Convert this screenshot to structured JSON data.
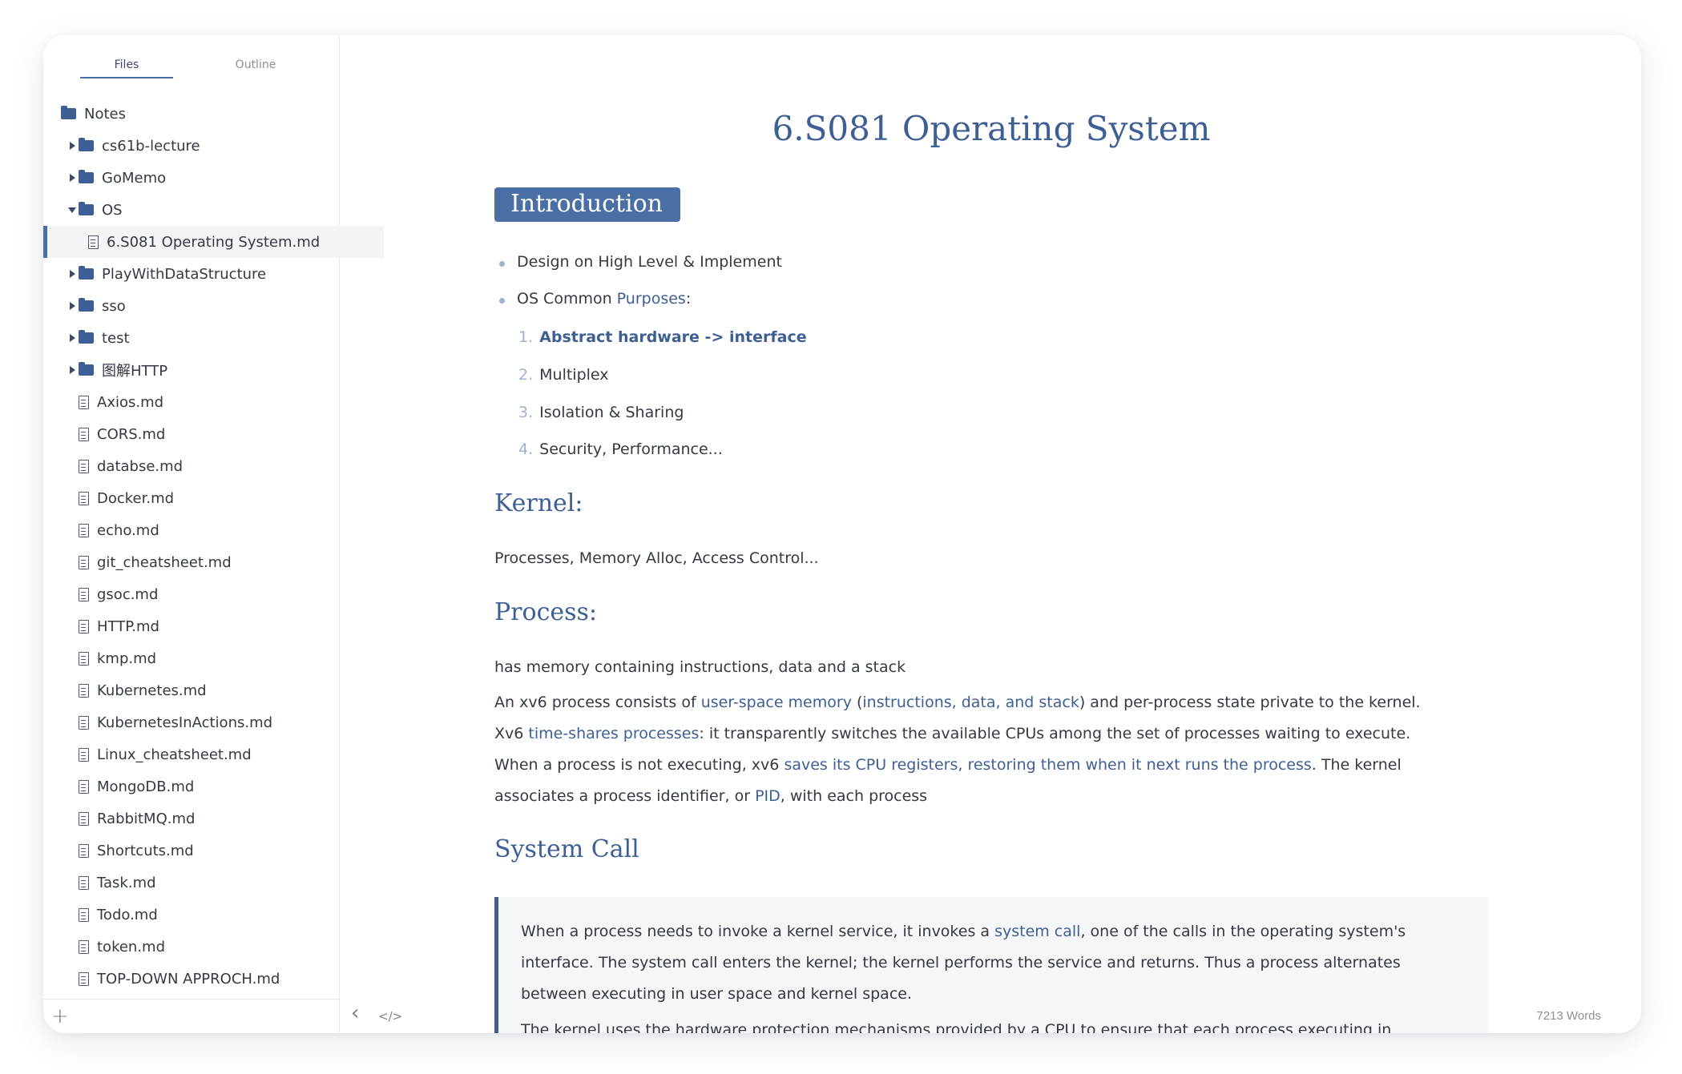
{
  "tabs": {
    "files": "Files",
    "outline": "Outline"
  },
  "tree": [
    {
      "label": "Notes",
      "type": "folder",
      "level": 0,
      "caret": "none"
    },
    {
      "label": "cs61b-lecture",
      "type": "folder",
      "level": 1,
      "caret": "right"
    },
    {
      "label": "GoMemo",
      "type": "folder",
      "level": 1,
      "caret": "right"
    },
    {
      "label": "OS",
      "type": "folder",
      "level": 1,
      "caret": "down"
    },
    {
      "label": "6.S081 Operating System.md",
      "type": "file",
      "level": 2,
      "selected": true
    },
    {
      "label": "PlayWithDataStructure",
      "type": "folder",
      "level": 1,
      "caret": "right"
    },
    {
      "label": "sso",
      "type": "folder",
      "level": 1,
      "caret": "right"
    },
    {
      "label": "test",
      "type": "folder",
      "level": 1,
      "caret": "right"
    },
    {
      "label": "图解HTTP",
      "type": "folder",
      "level": 1,
      "caret": "right"
    },
    {
      "label": "Axios.md",
      "type": "file",
      "level": 1
    },
    {
      "label": "CORS.md",
      "type": "file",
      "level": 1
    },
    {
      "label": "databse.md",
      "type": "file",
      "level": 1
    },
    {
      "label": "Docker.md",
      "type": "file",
      "level": 1
    },
    {
      "label": "echo.md",
      "type": "file",
      "level": 1
    },
    {
      "label": "git_cheatsheet.md",
      "type": "file",
      "level": 1
    },
    {
      "label": "gsoc.md",
      "type": "file",
      "level": 1
    },
    {
      "label": "HTTP.md",
      "type": "file",
      "level": 1
    },
    {
      "label": "kmp.md",
      "type": "file",
      "level": 1
    },
    {
      "label": "Kubernetes.md",
      "type": "file",
      "level": 1
    },
    {
      "label": "KubernetesInActions.md",
      "type": "file",
      "level": 1
    },
    {
      "label": "Linux_cheatsheet.md",
      "type": "file",
      "level": 1
    },
    {
      "label": "MongoDB.md",
      "type": "file",
      "level": 1
    },
    {
      "label": "RabbitMQ.md",
      "type": "file",
      "level": 1
    },
    {
      "label": "Shortcuts.md",
      "type": "file",
      "level": 1
    },
    {
      "label": "Task.md",
      "type": "file",
      "level": 1
    },
    {
      "label": "Todo.md",
      "type": "file",
      "level": 1
    },
    {
      "label": "token.md",
      "type": "file",
      "level": 1
    },
    {
      "label": "TOP-DOWN APPROCH.md",
      "type": "file",
      "level": 1
    }
  ],
  "sidebar_footer": {
    "add_label": "+"
  },
  "doc": {
    "title": "6.S081 Operating System",
    "intro_heading": "Introduction",
    "bullet1": "Design on High Level & Implement",
    "bullet2_pre": "OS Common ",
    "bullet2_link": "Purposes",
    "bullet2_post": ":",
    "num1_n": "1.",
    "num1": "Abstract hardware -> interface",
    "num2_n": "2.",
    "num2": "Multiplex",
    "num3_n": "3.",
    "num3": "Isolation & Sharing",
    "num4_n": "4.",
    "num4": "Security, Performance...",
    "kernel_heading": "Kernel:",
    "kernel_text": "Processes, Memory Alloc, Access Control...",
    "process_heading": "Process:",
    "process_text1": "has memory containing instructions, data and a stack",
    "p2_a": "An xv6 process consists of ",
    "p2_b": "user-space memory",
    "p2_c": " (",
    "p2_d": "instructions, data, and stack",
    "p2_e": ") and per-process state private to the kernel.",
    "p2_f": "Xv6 ",
    "p2_g": "time-shares processes",
    "p2_h": ": it transparently switches the available CPUs among the set of processes waiting to execute.",
    "p2_i": "When a process is not executing, xv6 ",
    "p2_j": "saves its CPU registers, restoring them when it next runs the process",
    "p2_k": ". The kernel",
    "p2_l": "associates a process identifier, or ",
    "p2_m": "PID",
    "p2_n": ", with each process",
    "syscall_heading": "System Call",
    "q1_a": "When a process needs to invoke a kernel service, it invokes a ",
    "q1_b": "system call",
    "q1_c": ", one of the calls in the operating system's",
    "q1_d": "interface. The system call enters the kernel; the kernel performs the service and returns. Thus a process alternates",
    "q1_e": "between executing in user space and kernel space.",
    "q2": "The kernel uses the hardware protection mechanisms provided by a CPU to ensure that each process executing in"
  },
  "footer": {
    "back_icon": "‹",
    "source_icon": "</>",
    "word_count": "7213 Words"
  }
}
